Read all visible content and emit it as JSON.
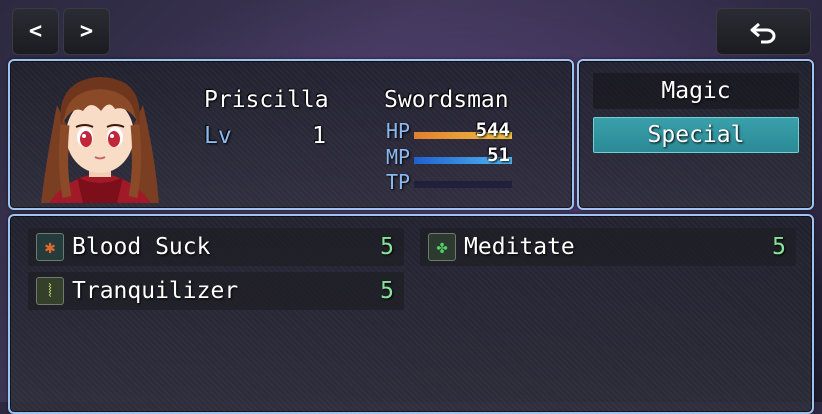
{
  "nav": {
    "prev_label": "<",
    "next_label": ">",
    "back_icon": "undo-arrow-icon"
  },
  "actor": {
    "name": "Priscilla",
    "class": "Swordsman",
    "level_label": "Lv",
    "level": "1",
    "hp_label": "HP",
    "hp": "544",
    "hp_fraction": 1.0,
    "mp_label": "MP",
    "mp": "51",
    "mp_fraction": 1.0,
    "tp_label": "TP",
    "tp_fraction": 0.0,
    "portrait": "anime-girl-portrait"
  },
  "skill_types": [
    {
      "label": "Magic",
      "selected": false
    },
    {
      "label": "Special",
      "selected": true
    }
  ],
  "skills": [
    {
      "icon": "blood-drain-icon",
      "name": "Blood Suck",
      "cost": "5"
    },
    {
      "icon": "clover-icon",
      "name": "Meditate",
      "cost": "5"
    },
    {
      "icon": "feather-icon",
      "name": "Tranquilizer",
      "cost": "5"
    }
  ],
  "colors": {
    "window_border": "#9ec3ef",
    "system_text": "#8ab8f0",
    "mp_cost_text": "#86e49a",
    "hp_gauge_start": "#e08030",
    "hp_gauge_end": "#f0c040",
    "mp_gauge_start": "#2060d0",
    "mp_gauge_end": "#50b8f0",
    "selected_command": "#2a8a96"
  }
}
